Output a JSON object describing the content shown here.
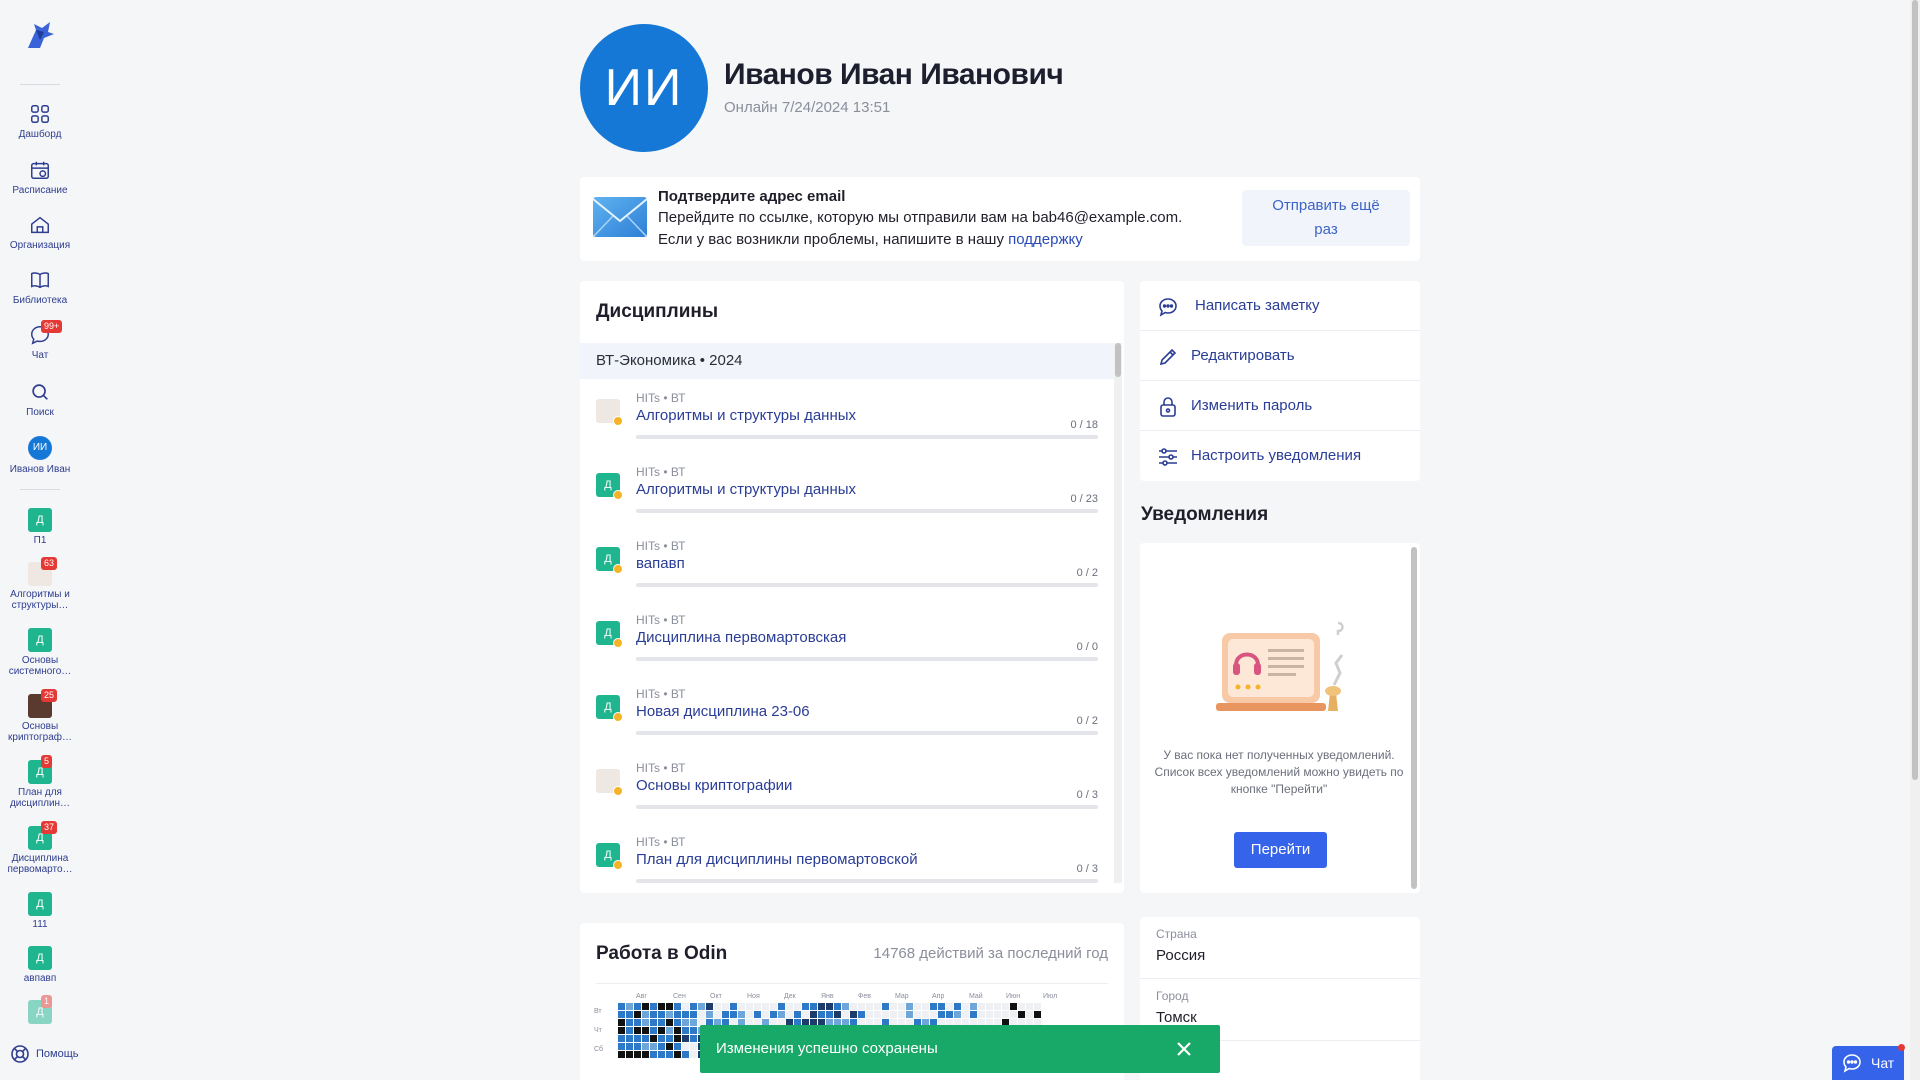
{
  "sidebar": {
    "nav": [
      {
        "label": "Дашборд",
        "icon": "dashboard-icon"
      },
      {
        "label": "Расписание",
        "icon": "calendar-icon"
      },
      {
        "label": "Организация",
        "icon": "home-icon"
      },
      {
        "label": "Библиотека",
        "icon": "book-icon"
      },
      {
        "label": "Чат",
        "icon": "chat-icon",
        "badge": "99+"
      },
      {
        "label": "Поиск",
        "icon": "search-icon"
      },
      {
        "label": "Иванов Иван",
        "avatar": "ИИ"
      }
    ],
    "courses": [
      {
        "letter": "Д",
        "label": "П1"
      },
      {
        "letter": "",
        "label": "Алгоритмы и структуры…",
        "badge": "63"
      },
      {
        "letter": "Д",
        "label": "Основы системного…"
      },
      {
        "letter": "",
        "label": "Основы криптограф…",
        "badge": "25"
      },
      {
        "letter": "Д",
        "label": "План для дисциплин…",
        "badge": "5"
      },
      {
        "letter": "Д",
        "label": "Дисциплина первомарто…",
        "badge": "37"
      },
      {
        "letter": "Д",
        "label": "111"
      },
      {
        "letter": "Д",
        "label": "авпавп"
      },
      {
        "letter": "Д",
        "label": "",
        "badge": "1"
      }
    ],
    "help_label": "Помощь"
  },
  "profile": {
    "initials": "ИИ",
    "name": "Иванов Иван Иванович",
    "status": "Онлайн 7/24/2024 13:51"
  },
  "email_confirm": {
    "title": "Подтвердите адрес email",
    "line1": "Перейдите по ссылке, которую мы отправили вам на bab46@example.com.",
    "line2_prefix": "Если у вас возникли проблемы, напишите в нашу ",
    "line2_link": "поддержку",
    "resend_line1": "Отправить ещё",
    "resend_line2": "раз"
  },
  "disciplines": {
    "title": "Дисциплины",
    "group": "ВТ-Экономика • 2024",
    "items": [
      {
        "sub": "HITs • ВТ",
        "name": "Алгоритмы и структуры данных",
        "count": "0 / 18",
        "icon": "",
        "image": true
      },
      {
        "sub": "HITs • ВТ",
        "name": "Алгоритмы и структуры данных",
        "count": "0 / 23",
        "icon": "Д"
      },
      {
        "sub": "HITs • ВТ",
        "name": "вапавп",
        "count": "0 / 2",
        "icon": "Д"
      },
      {
        "sub": "HITs • ВТ",
        "name": "Дисциплина первомартовская",
        "count": "0 / 0",
        "icon": "Д"
      },
      {
        "sub": "HITs • ВТ",
        "name": "Новая дисциплина 23-06",
        "count": "0 / 2",
        "icon": "Д"
      },
      {
        "sub": "HITs • ВТ",
        "name": "Основы криптографии",
        "count": "0 / 3",
        "icon": "",
        "image": true
      },
      {
        "sub": "HITs • ВТ",
        "name": "План для дисциплины первомартовской",
        "count": "0 / 3",
        "icon": "Д"
      }
    ]
  },
  "actions": [
    {
      "label": "Написать заметку",
      "icon": "comment-icon"
    },
    {
      "label": "Редактировать",
      "icon": "pencil-icon"
    },
    {
      "label": "Изменить пароль",
      "icon": "lock-icon"
    },
    {
      "label": "Настроить уведомления",
      "icon": "sliders-icon"
    }
  ],
  "notifications": {
    "title": "Уведомления",
    "empty_text": "У вас пока нет полученных уведомлений. Список всех уведомлений можно увидеть по кнопке \"Перейти\"",
    "go_label": "Перейти"
  },
  "activity": {
    "title": "Работа в Odin",
    "summary": "14768 действий за последний год",
    "months": [
      "Авг",
      "Сен",
      "Окт",
      "Ноя",
      "Дек",
      "Янв",
      "Фев",
      "Мар",
      "Апр",
      "Май",
      "Июн",
      "Июл"
    ],
    "days": [
      "Вт",
      "Чт",
      "Сб"
    ]
  },
  "info": [
    {
      "key": "Страна",
      "value": "Россия"
    },
    {
      "key": "Город",
      "value": "Томск"
    }
  ],
  "toast": {
    "message": "Изменения успешно сохранены"
  },
  "chat_button": {
    "label": "Чат"
  },
  "colors": {
    "accent": "#3563e9",
    "avatar": "#1577d6",
    "course": "#1fb58f",
    "toast": "#18a868",
    "badge": "#e53935"
  }
}
